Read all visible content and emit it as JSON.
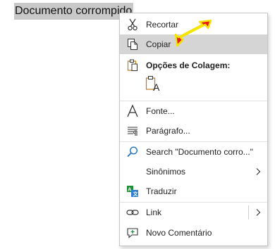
{
  "document": {
    "selected_text": "Documento corrompido"
  },
  "menu": {
    "cut": "Recortar",
    "copy": "Copiar",
    "paste_options": "Opções de Colagem:",
    "font": "Fonte...",
    "paragraph": "Parágrafo...",
    "search": "Search \"Documento corro...\"",
    "synonyms": "Sinônimos",
    "translate": "Traduzir",
    "link": "Link",
    "new_comment": "Novo Comentário"
  },
  "colors": {
    "highlight": "#d5d5d5",
    "selection": "#c8c8c8",
    "arrow_fill": "#e8181c",
    "arrow_outline": "#f5e400"
  },
  "icons": [
    "scissors-icon",
    "copy-icon",
    "clipboard-icon",
    "paste-keep-text-icon",
    "font-icon",
    "paragraph-icon",
    "search-icon",
    "translate-icon",
    "link-icon",
    "comment-icon",
    "chevron-right-icon",
    "arrow-pointer"
  ]
}
